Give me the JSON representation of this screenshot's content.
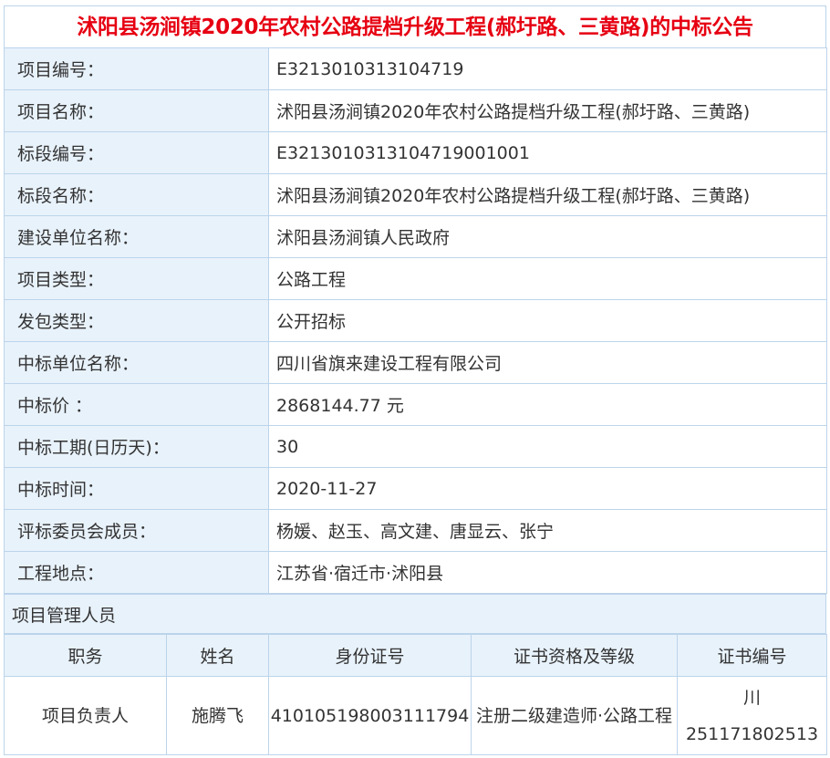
{
  "title": "沭阳县汤涧镇2020年农村公路提档升级工程(郝圩路、三黄路)的中标公告",
  "rows": [
    {
      "label": "项目编号：",
      "value": "E3213010313104719"
    },
    {
      "label": "项目名称：",
      "value": "沭阳县汤涧镇2020年农村公路提档升级工程(郝圩路、三黄路)"
    },
    {
      "label": "标段编号：",
      "value": "E3213010313104719001001"
    },
    {
      "label": "标段名称：",
      "value": "沭阳县汤涧镇2020年农村公路提档升级工程(郝圩路、三黄路)"
    },
    {
      "label": "建设单位名称：",
      "value": "沭阳县汤涧镇人民政府"
    },
    {
      "label": "项目类型：",
      "value": "公路工程"
    },
    {
      "label": "发包类型：",
      "value": "公开招标"
    },
    {
      "label": "中标单位名称：",
      "value": "四川省旗来建设工程有限公司"
    },
    {
      "label": "中标价 ：",
      "value": "2868144.77 元"
    },
    {
      "label": "中标工期(日历天)：",
      "value": "30"
    },
    {
      "label": "中标时间：",
      "value": "2020-11-27"
    },
    {
      "label": "评标委员会成员：",
      "value": "杨媛、赵玉、高文建、唐显云、张宁"
    },
    {
      "label": "工程地点：",
      "value": "江苏省·宿迁市·沭阳县"
    }
  ],
  "staff_section": "项目管理人员",
  "staff_headers": [
    "职务",
    "姓名",
    "身份证号",
    "证书资格及等级",
    "证书编号"
  ],
  "staff_rows": [
    [
      "项目负责人",
      "施腾飞",
      "410105198003111794",
      "注册二级建造师·公路工程",
      "川251171802513"
    ]
  ]
}
